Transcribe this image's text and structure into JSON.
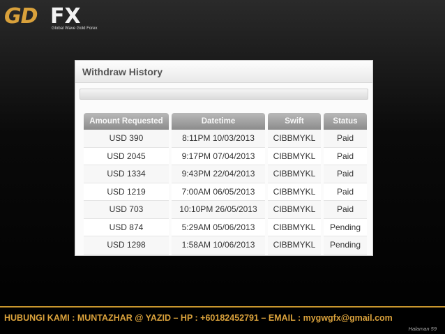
{
  "logo": {
    "brand_left": "GD",
    "brand_right": "FX",
    "tagline": "Global Wave Gold Forex"
  },
  "panel": {
    "title": "Withdraw History"
  },
  "table": {
    "headers": [
      "Amount Requested",
      "Datetime",
      "Swift",
      "Status"
    ],
    "rows": [
      [
        "USD 390",
        "8:11PM 10/03/2013",
        "CIBBMYKL",
        "Paid"
      ],
      [
        "USD 2045",
        "9:17PM 07/04/2013",
        "CIBBMYKL",
        "Paid"
      ],
      [
        "USD 1334",
        "9:43PM 22/04/2013",
        "CIBBMYKL",
        "Paid"
      ],
      [
        "USD 1219",
        "7:00AM 06/05/2013",
        "CIBBMYKL",
        "Paid"
      ],
      [
        "USD 703",
        "10:10PM 26/05/2013",
        "CIBBMYKL",
        "Paid"
      ],
      [
        "USD 874",
        "5:29AM 05/06/2013",
        "CIBBMYKL",
        "Pending"
      ],
      [
        "USD 1298",
        "1:58AM 10/06/2013",
        "CIBBMYKL",
        "Pending"
      ]
    ]
  },
  "footer": {
    "contact": "HUBUNGI KAMI :   MUNTAZHAR @ YAZID –   HP : +60182452791   –   EMAIL : mygwgfx@gmail.com",
    "page": "Halaman 59"
  },
  "colors": {
    "accent_gold": "#d9a13b",
    "background": "#000000"
  }
}
